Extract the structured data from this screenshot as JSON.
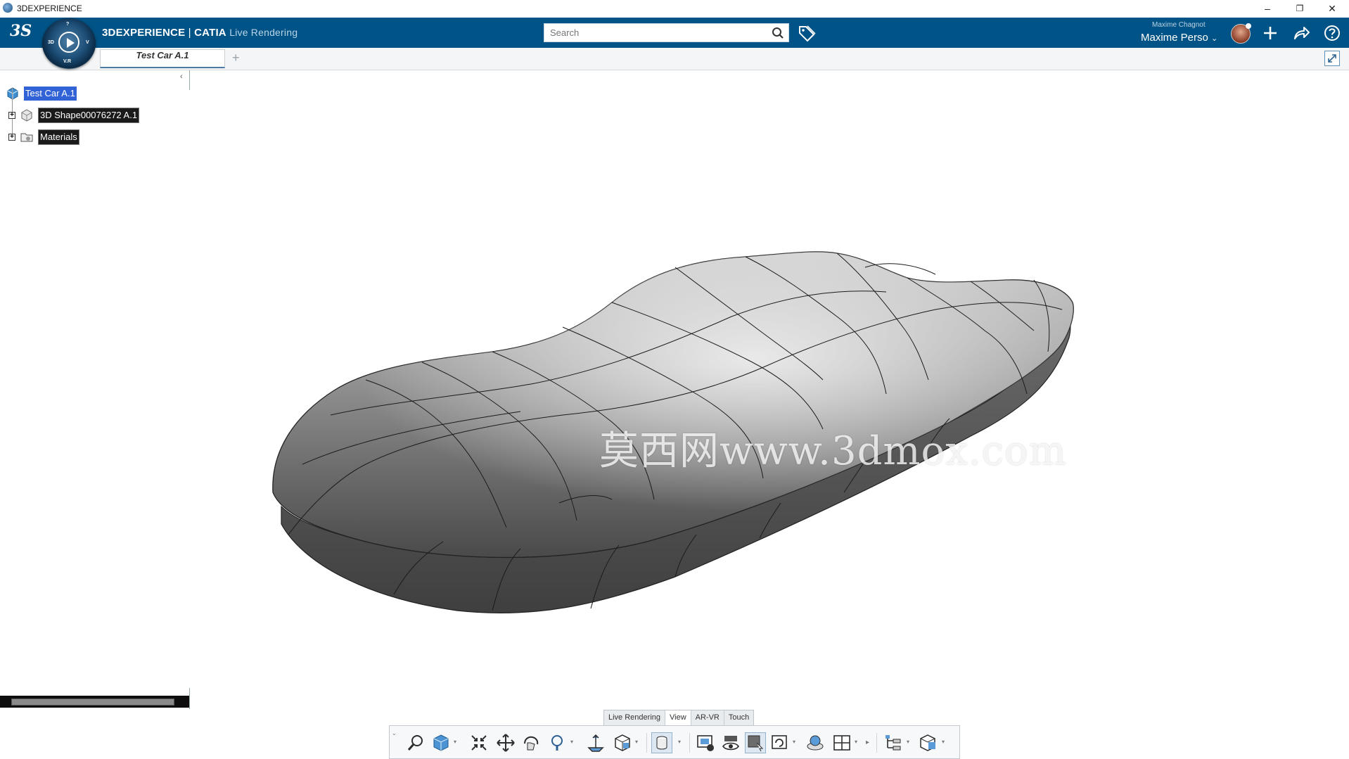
{
  "os": {
    "title": "3DEXPERIENCE",
    "minimize": "–",
    "restore": "❐",
    "close": "✕"
  },
  "app": {
    "brand": "3DEXPERIENCE",
    "separator": " | ",
    "product": "CATIA",
    "app_name": "Live Rendering",
    "logo_text": "3S"
  },
  "compass": {
    "top": "?",
    "left": "3D",
    "right": "V",
    "bottom": "V.R"
  },
  "search": {
    "placeholder": "Search",
    "value": ""
  },
  "user": {
    "full_name": "Maxime Chagnot",
    "display_name": "Maxime Perso"
  },
  "tabs": [
    {
      "label": "Test Car A.1"
    }
  ],
  "tab_add_label": "+",
  "tree": [
    {
      "label": "Test Car A.1",
      "selected": true
    },
    {
      "label": "3D Shape00076272 A.1"
    },
    {
      "label": "Materials"
    }
  ],
  "watermark": "莫西网www.3dmox.com",
  "section_tabs": [
    {
      "label": "Live Rendering"
    },
    {
      "label": "View",
      "active": true
    },
    {
      "label": "AR-VR"
    },
    {
      "label": "Touch"
    }
  ],
  "toolbar_icons": [
    "expand-toolbar-icon",
    "zoom-area-icon",
    "view-cube-icon",
    "fit-all-icon",
    "pan-icon",
    "rotate-icon",
    "zoom-icon",
    "normal-view-icon",
    "multi-view-icon",
    "shading-icon",
    "render-settings-icon",
    "hide-show-icon",
    "selection-filter-icon",
    "refresh-view-icon",
    "sync-icon",
    "layout-icon",
    "tree-view-icon",
    "capture-icon"
  ],
  "colors": {
    "appbar": "#005386",
    "selection": "#3163d6",
    "body_shade": "#8c8c8c"
  }
}
